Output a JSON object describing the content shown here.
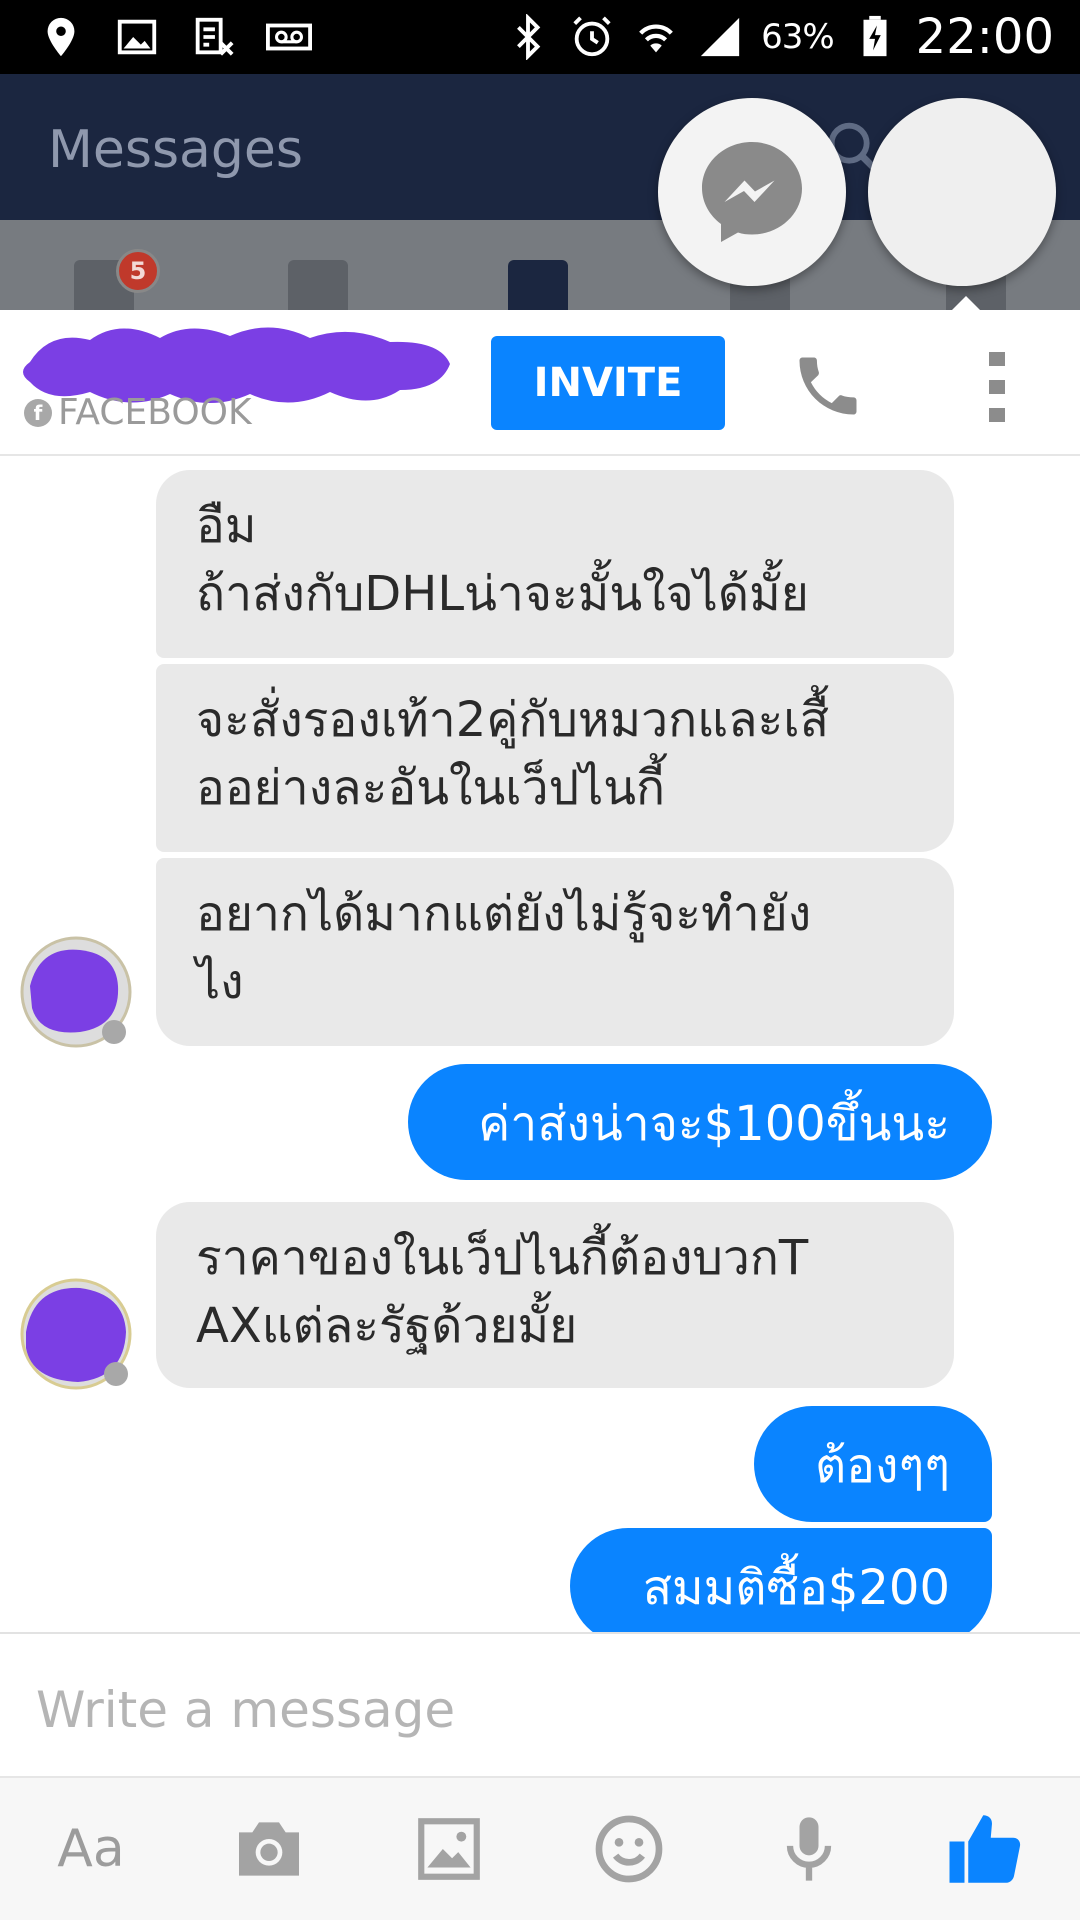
{
  "status_bar": {
    "battery_percent": "63%",
    "time": "22:00"
  },
  "app_header": {
    "title": "Messages",
    "notification_count": "5"
  },
  "chat": {
    "source_label": "FACEBOOK",
    "invite_label": "INVITE",
    "messages": [
      {
        "direction": "incoming",
        "text": "อืม\nถ้าส่งกับDHLน่าจะมั้นใจได้มั้ย"
      },
      {
        "direction": "incoming",
        "text": "จะสั่งรองเท้า2คู่กับหมวกและเสื้\nออย่างละอันในเว็ปไนกี้"
      },
      {
        "direction": "incoming",
        "text": "อยากได้มากแต่ยังไม่รู้จะทำยัง\nไง"
      },
      {
        "direction": "outgoing",
        "text": "ค่าส่งน่าจะ$100ขึ้นนะ"
      },
      {
        "direction": "incoming",
        "text": "ราคาของในเว็ปไนกี้ต้องบวกT\nAXแต่ละรัฐด้วยมั้ย"
      },
      {
        "direction": "outgoing",
        "text": "ต้องๆๆ"
      },
      {
        "direction": "outgoing",
        "text": "สมมติซื้อ$200"
      }
    ]
  },
  "composer": {
    "placeholder": "Write a message",
    "aa_label": "Aa"
  },
  "colors": {
    "accent": "#0a84ff",
    "redaction": "#7b3fe4",
    "header_bg": "#1b2640"
  }
}
